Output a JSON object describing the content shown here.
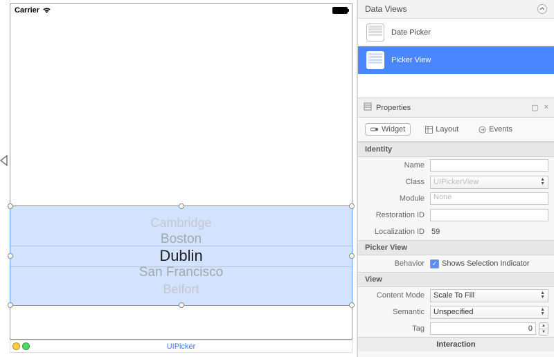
{
  "statusbar": {
    "carrier": "Carrier"
  },
  "picker": {
    "items": [
      "Cambridge",
      "Boston",
      "Dublin",
      "San Francisco",
      "Belfort"
    ],
    "doc_label": "UIPicker"
  },
  "library": {
    "title": "Data Views",
    "items": [
      {
        "label": "Date Picker",
        "active": false
      },
      {
        "label": "Picker View",
        "active": true
      }
    ]
  },
  "properties": {
    "title": "Properties",
    "tabs": {
      "widget": "Widget",
      "layout": "Layout",
      "events": "Events"
    },
    "sections": {
      "identity": {
        "title": "Identity",
        "name_label": "Name",
        "name_value": "",
        "class_label": "Class",
        "class_value": "UIPickerView",
        "module_label": "Module",
        "module_value": "None",
        "restoration_label": "Restoration ID",
        "restoration_value": "",
        "localization_label": "Localization ID",
        "localization_value": "59"
      },
      "pickerview": {
        "title": "Picker View",
        "behavior_label": "Behavior",
        "behavior_checkbox": "Shows Selection Indicator"
      },
      "view": {
        "title": "View",
        "contentmode_label": "Content Mode",
        "contentmode_value": "Scale To Fill",
        "semantic_label": "Semantic",
        "semantic_value": "Unspecified",
        "tag_label": "Tag",
        "tag_value": "0"
      },
      "interaction": {
        "title": "Interaction"
      }
    }
  }
}
